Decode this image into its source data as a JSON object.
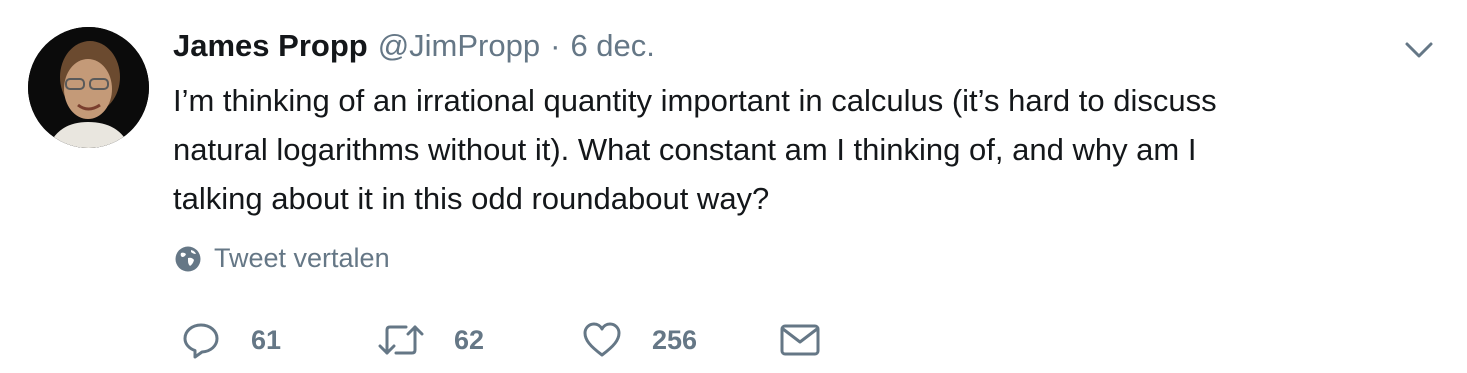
{
  "tweet": {
    "author_name": "James Propp",
    "author_handle": "@JimPropp",
    "separator": "·",
    "timestamp": "6 dec.",
    "text": "I’m thinking of an irrational quantity important in calculus (it’s hard to discuss\nnatural logarithms without it). What constant am I thinking of, and why am I\ntalking about it in this odd roundabout way?",
    "translate_label": "Tweet vertalen"
  },
  "actions": {
    "reply_count": "61",
    "retweet_count": "62",
    "like_count": "256"
  },
  "icons": {
    "avatar": "avatar",
    "caret": "chevron-down-icon",
    "translate": "globe-icon",
    "reply": "reply-icon",
    "retweet": "retweet-icon",
    "like": "heart-icon",
    "dm": "envelope-icon"
  },
  "colors": {
    "text": "#14171a",
    "secondary": "#657786"
  }
}
